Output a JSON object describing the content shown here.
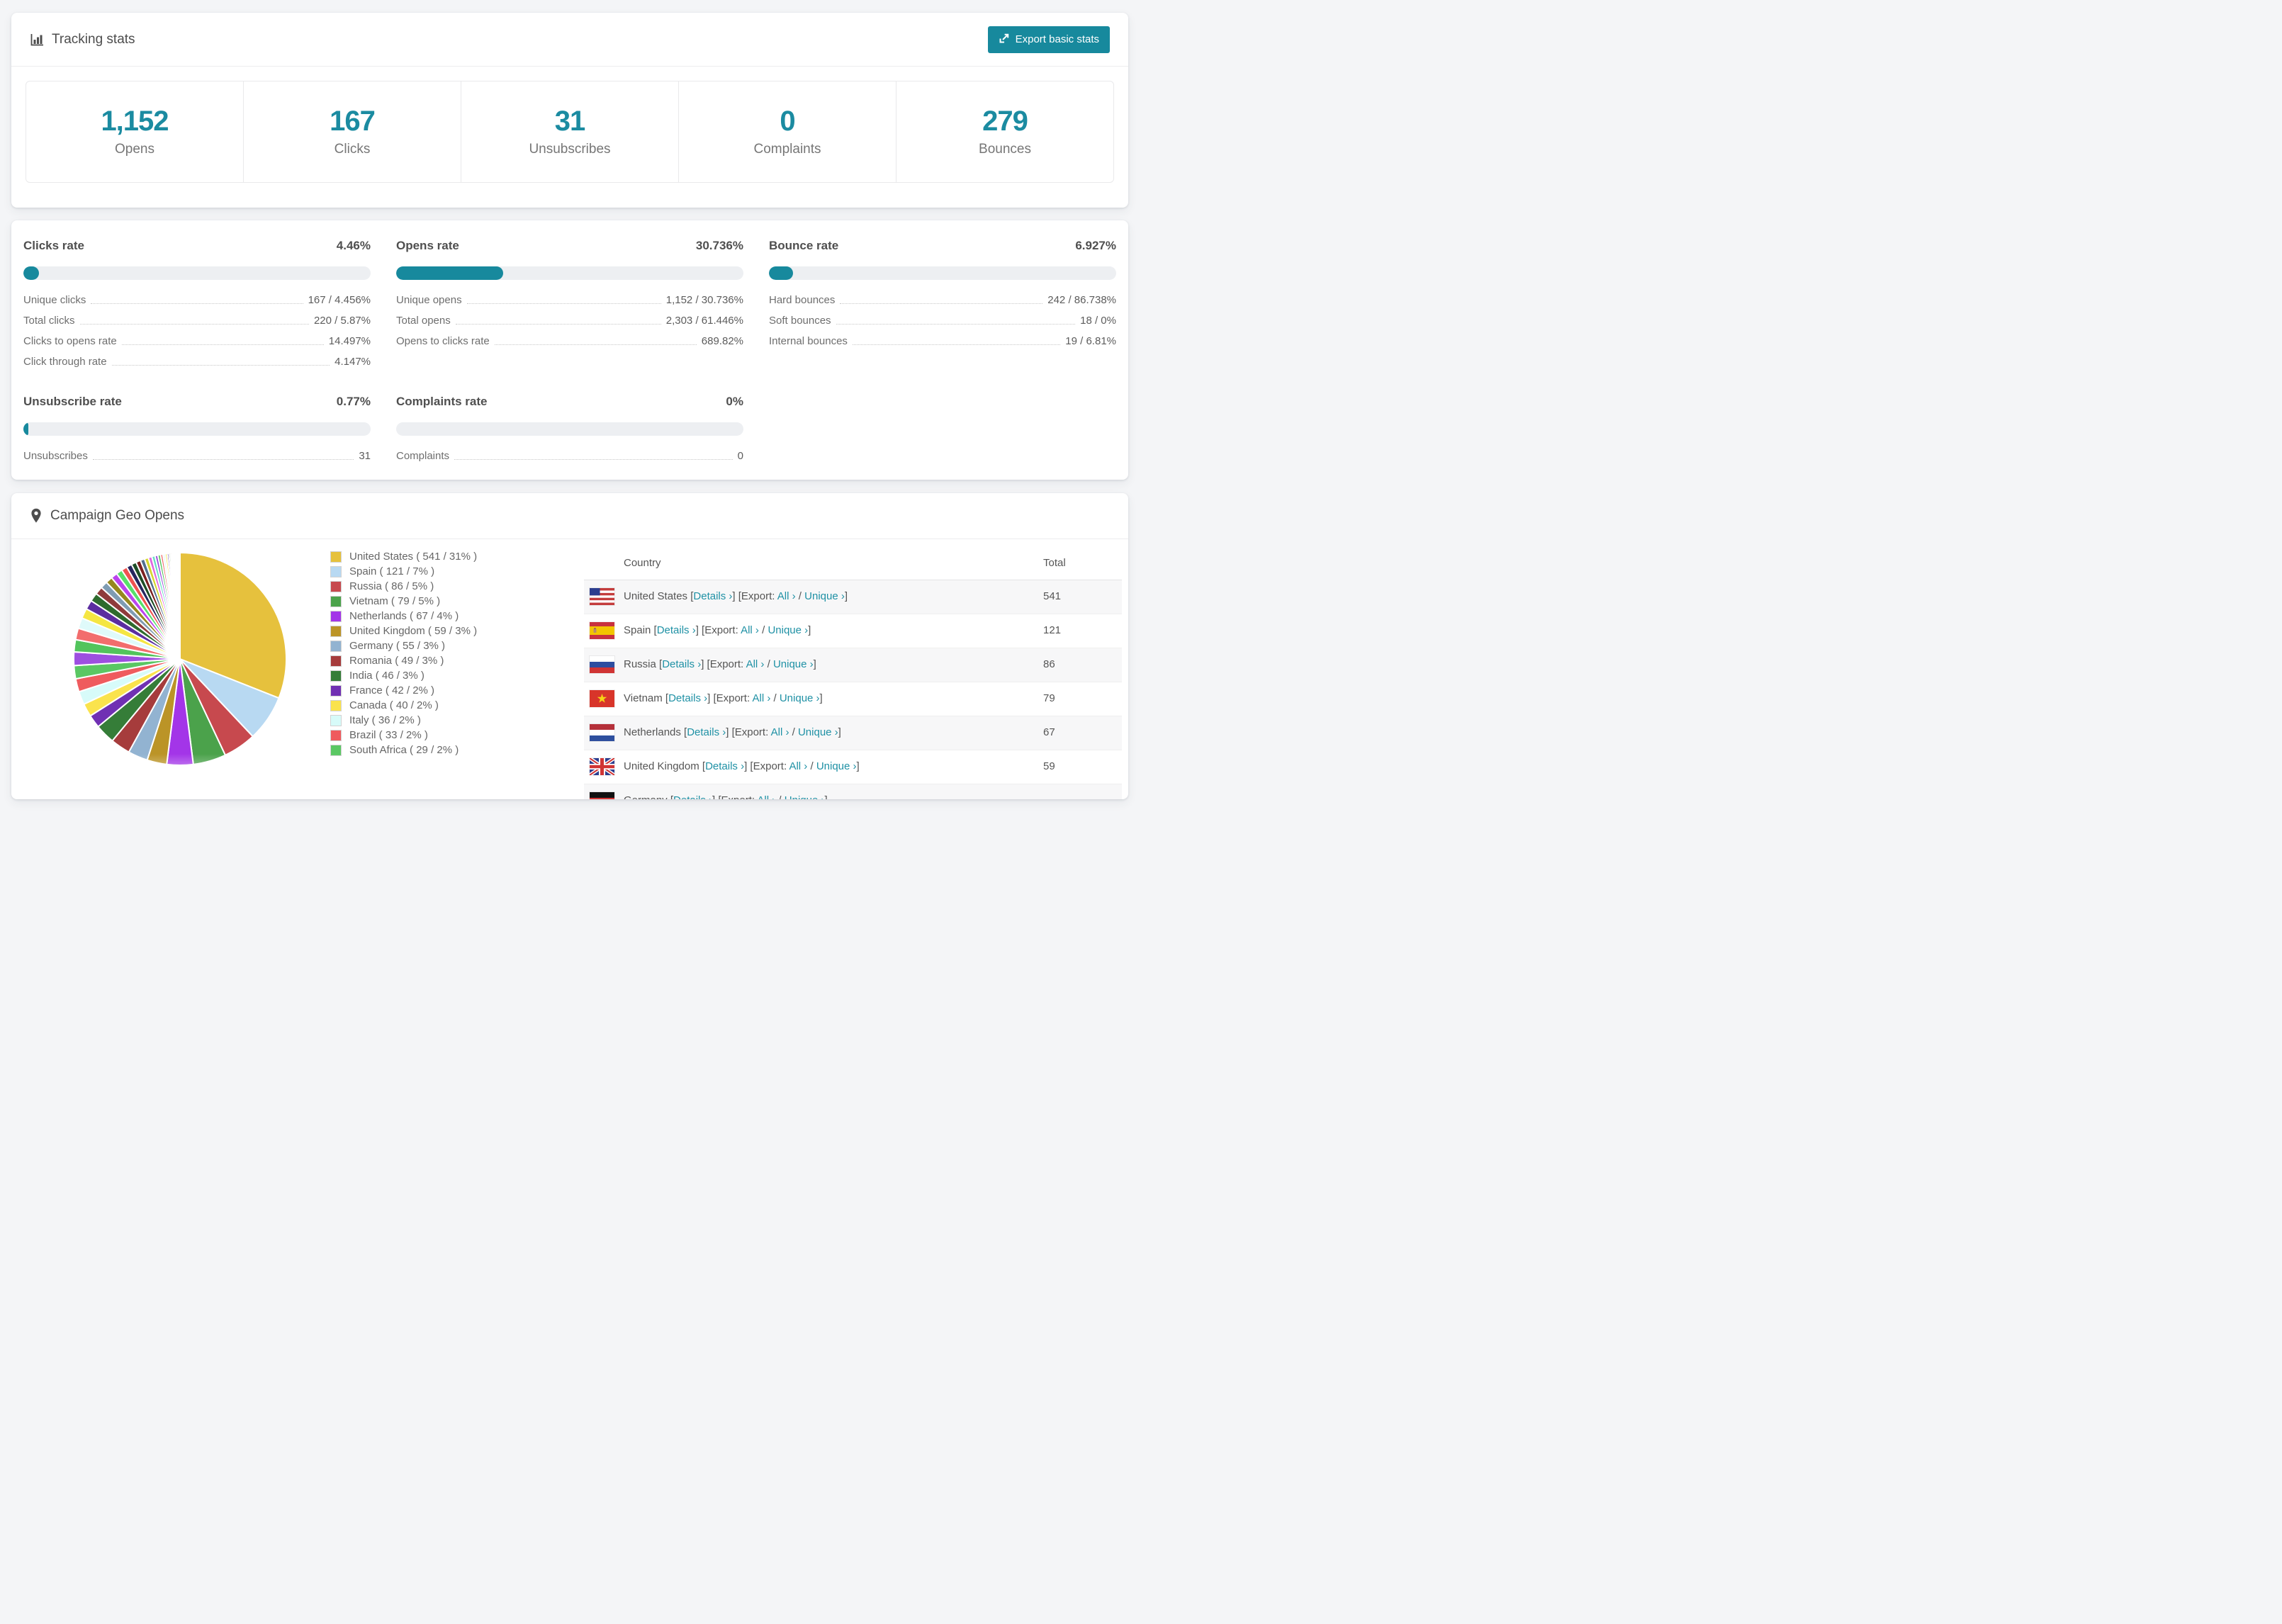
{
  "page": {
    "background": "#f4f5f7",
    "accent": "#17899d"
  },
  "tracking": {
    "title": "Tracking stats",
    "icon": "bar-chart-icon",
    "export_button": "Export basic stats",
    "stats": [
      {
        "value": "1,152",
        "label": "Opens"
      },
      {
        "value": "167",
        "label": "Clicks"
      },
      {
        "value": "31",
        "label": "Unsubscribes"
      },
      {
        "value": "0",
        "label": "Complaints"
      },
      {
        "value": "279",
        "label": "Bounces"
      }
    ]
  },
  "rates": [
    {
      "title": "Clicks rate",
      "pct": "4.46%",
      "bar_pct": 4.46,
      "rows": [
        {
          "label": "Unique clicks",
          "value": "167 / 4.456%"
        },
        {
          "label": "Total clicks",
          "value": "220 / 5.87%"
        },
        {
          "label": "Clicks to opens rate",
          "value": "14.497%"
        },
        {
          "label": "Click through rate",
          "value": "4.147%"
        }
      ]
    },
    {
      "title": "Opens rate",
      "pct": "30.736%",
      "bar_pct": 30.736,
      "rows": [
        {
          "label": "Unique opens",
          "value": "1,152 / 30.736%"
        },
        {
          "label": "Total opens",
          "value": "2,303 / 61.446%"
        },
        {
          "label": "Opens to clicks rate",
          "value": "689.82%"
        }
      ]
    },
    {
      "title": "Bounce rate",
      "pct": "6.927%",
      "bar_pct": 6.927,
      "rows": [
        {
          "label": "Hard bounces",
          "value": "242 / 86.738%"
        },
        {
          "label": "Soft bounces",
          "value": "18 / 0%"
        },
        {
          "label": "Internal bounces",
          "value": "19 / 6.81%"
        }
      ]
    },
    {
      "title": "Unsubscribe rate",
      "pct": "0.77%",
      "bar_pct": 0.77,
      "rows": [
        {
          "label": "Unsubscribes",
          "value": "31"
        }
      ]
    },
    {
      "title": "Complaints rate",
      "pct": "0%",
      "bar_pct": 0,
      "rows": [
        {
          "label": "Complaints",
          "value": "0"
        }
      ]
    }
  ],
  "geo": {
    "title": "Campaign Geo Opens",
    "icon": "map-pin-icon",
    "table": {
      "headers": [
        "Country",
        "Total"
      ],
      "link_labels": {
        "details": "Details",
        "export_prefix": "Export:",
        "all": "All",
        "unique": "Unique",
        "chevron": "›"
      },
      "rows": [
        {
          "country": "United States",
          "flag": "us",
          "total": "541"
        },
        {
          "country": "Spain",
          "flag": "es",
          "total": "121"
        },
        {
          "country": "Russia",
          "flag": "ru",
          "total": "86"
        },
        {
          "country": "Vietnam",
          "flag": "vn",
          "total": "79"
        },
        {
          "country": "Netherlands",
          "flag": "nl",
          "total": "67"
        },
        {
          "country": "United Kingdom",
          "flag": "gb",
          "total": "59"
        },
        {
          "country": "Germany",
          "flag": "de",
          "total": "",
          "partially_visible": true
        }
      ]
    }
  },
  "chart_data": {
    "type": "pie",
    "title": "Campaign Geo Opens",
    "legend_position": "right-of-pie",
    "start_angle_deg": -90,
    "direction": "clockwise",
    "series": [
      {
        "name": "United States",
        "value": 541,
        "pct_num": 31,
        "color": "#e6c13d"
      },
      {
        "name": "Spain",
        "value": 121,
        "pct_num": 7,
        "color": "#b8d9f2"
      },
      {
        "name": "Russia",
        "value": 86,
        "pct_num": 5,
        "color": "#c7494e"
      },
      {
        "name": "Vietnam",
        "value": 79,
        "pct_num": 5,
        "color": "#4ba24b"
      },
      {
        "name": "Netherlands",
        "value": 67,
        "pct_num": 4,
        "color": "#a335e8"
      },
      {
        "name": "United Kingdom",
        "value": 59,
        "pct_num": 3,
        "color": "#bb9427"
      },
      {
        "name": "Germany",
        "value": 55,
        "pct_num": 3,
        "color": "#92b3d1"
      },
      {
        "name": "Romania",
        "value": 49,
        "pct_num": 3,
        "color": "#a63c3c"
      },
      {
        "name": "India",
        "value": 46,
        "pct_num": 3,
        "color": "#357d38"
      },
      {
        "name": "France",
        "value": 42,
        "pct_num": 2,
        "color": "#7030b3"
      },
      {
        "name": "Canada",
        "value": 40,
        "pct_num": 2,
        "color": "#fae34d"
      },
      {
        "name": "Italy",
        "value": 36,
        "pct_num": 2,
        "color": "#d7fbf9"
      },
      {
        "name": "Brazil",
        "value": 33,
        "pct_num": 2,
        "color": "#ef5b5e"
      },
      {
        "name": "South Africa",
        "value": 29,
        "pct_num": 2,
        "color": "#5ac763"
      }
    ],
    "others": {
      "note": "many small unlabeled slices, ~26% combined",
      "combined_pct_num": 26,
      "weights": [
        19,
        17,
        16,
        15,
        14,
        13,
        12,
        11,
        10,
        9.5,
        9,
        8.5,
        8,
        7.5,
        7,
        6.5,
        6,
        5.5,
        5,
        4.5,
        4,
        3.7,
        3.4,
        3.1,
        2.8,
        2.5,
        2.2,
        2,
        1.8,
        1.6,
        1.4,
        1.2,
        1,
        0.9,
        0.8,
        0.7,
        0.6,
        0.5,
        0.4,
        0.3
      ],
      "palette": [
        "#9d4fe0",
        "#52c45c",
        "#f26d6d",
        "#dffafa",
        "#f5e642",
        "#5b2da0",
        "#2e6b2e",
        "#8f3b3b",
        "#7f9cb3",
        "#96871f",
        "#bb44ee",
        "#57e06a",
        "#ef5350",
        "#26265e",
        "#1d4d26",
        "#7a2020",
        "#51708f",
        "#d6d62e",
        "#e066e0",
        "#66e0c2"
      ]
    }
  }
}
